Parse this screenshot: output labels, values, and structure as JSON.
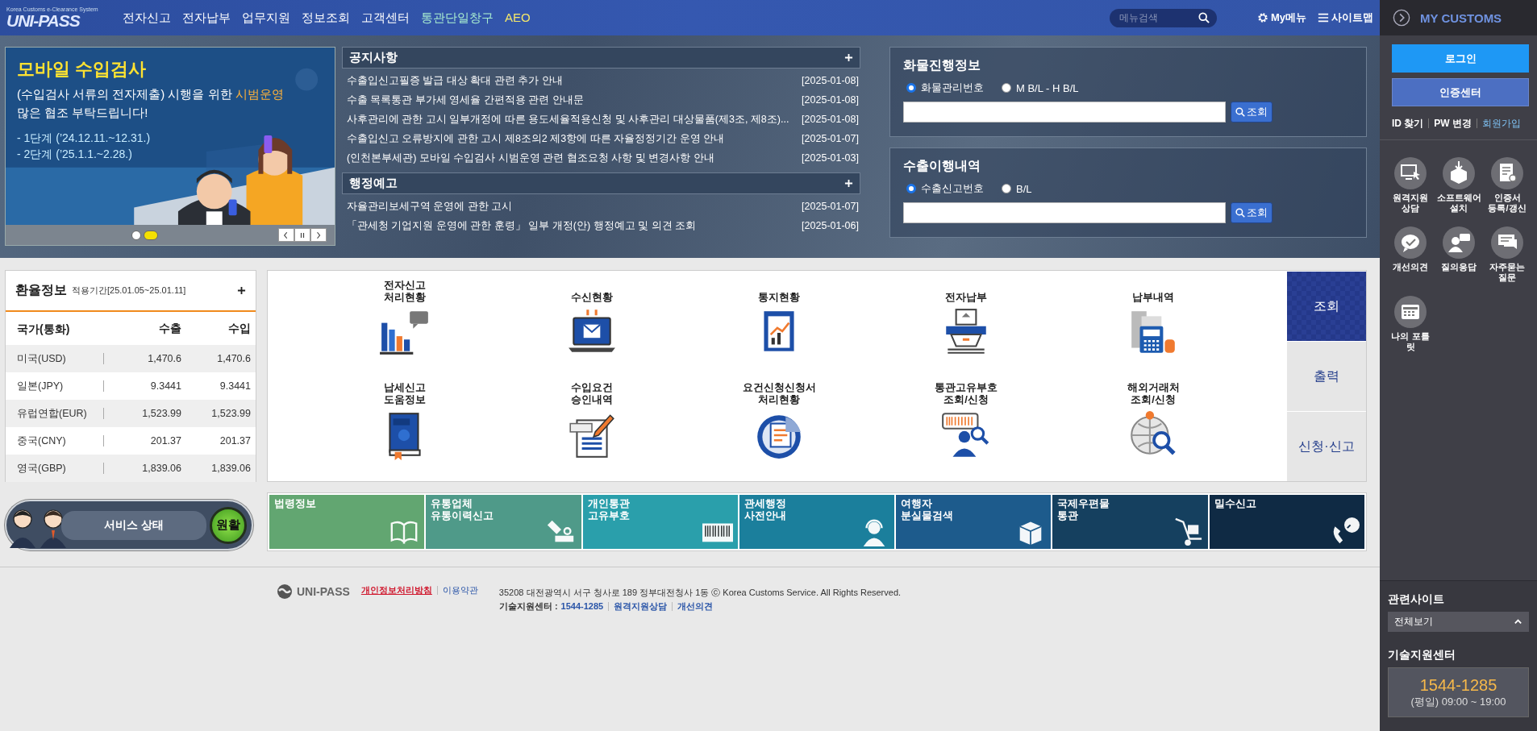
{
  "header": {
    "logo": {
      "tagline": "Korea Customs e-Clearance System",
      "name": "UNI-PASS"
    },
    "nav": [
      {
        "label": "전자신고",
        "color": "#ffffff"
      },
      {
        "label": "전자납부",
        "color": "#ffffff"
      },
      {
        "label": "업무지원",
        "color": "#ffffff"
      },
      {
        "label": "정보조회",
        "color": "#ffffff"
      },
      {
        "label": "고객센터",
        "color": "#ffffff"
      },
      {
        "label": "통관단일창구",
        "color": "#a8ecd0"
      },
      {
        "label": "AEO",
        "color": "#f4e76a"
      }
    ],
    "search": {
      "placeholder": "메뉴검색"
    },
    "utility_links": [
      {
        "label": "My메뉴",
        "kind": "gear"
      },
      {
        "label": "사이트맵",
        "kind": "menu"
      }
    ]
  },
  "banner": {
    "title": "모바일 수입검사",
    "subtitle": "(수입검사 서류의 전자제출) 시행을 위한",
    "highlight": "시범운영",
    "line": "많은 협조 부탁드립니다!",
    "steps": [
      "- 1단계 (’24.12.11.~12.31.)",
      "- 2단계 (’25.1.1.~2.28.)"
    ],
    "indicators": [
      {
        "selected": false
      },
      {
        "selected": true
      }
    ]
  },
  "notices": [
    {
      "title": "공지사항",
      "items": [
        {
          "title": "수출입신고필증 발급 대상 확대 관련 추가 안내",
          "date": "[2025-01-08]"
        },
        {
          "title": "수출 목록통관 부가세 영세율 간편적용 관련 안내문",
          "date": "[2025-01-08]"
        },
        {
          "title": "사후관리에 관한 고시 일부개정에 따른 용도세율적용신청 및 사후관리 대상물품(제3조, 제8조)...",
          "date": "[2025-01-08]"
        },
        {
          "title": "수출입신고 오류방지에 관한 고시 제8조의2 제3항에 따른 자율정정기간 운영 안내",
          "date": "[2025-01-07]"
        },
        {
          "title": "(인천본부세관) 모바일 수입검사 시범운영 관련 협조요청 사항 및 변경사항 안내",
          "date": "[2025-01-03]"
        }
      ]
    },
    {
      "title": "행정예고",
      "items": [
        {
          "title": "자율관리보세구역 운영에 관한 고시",
          "date": "[2025-01-07]"
        },
        {
          "title": "「관세청 기업지원 운영에 관한 훈령」 일부 개정(안) 행정예고 및 의견 조회",
          "date": "[2025-01-06]"
        }
      ]
    }
  ],
  "tracking": [
    {
      "title": "화물진행정보",
      "options": [
        {
          "label": "화물관리번호",
          "selected": true
        },
        {
          "label": "M B/L - H B/L",
          "selected": false
        }
      ],
      "button": "조회"
    },
    {
      "title": "수출이행내역",
      "options": [
        {
          "label": "수출신고번호",
          "selected": true
        },
        {
          "label": "B/L",
          "selected": false
        }
      ],
      "button": "조회"
    }
  ],
  "exchange": {
    "title": "환율정보",
    "period": "적용기간[25.01.05~25.01.11]",
    "columns": [
      "국가(통화)",
      "수출",
      "수입"
    ],
    "rows": [
      [
        "미국(USD)",
        "1,470.6",
        "1,470.6"
      ],
      [
        "일본(JPY)",
        "9.3441",
        "9.3441"
      ],
      [
        "유럽연합(EUR)",
        "1,523.99",
        "1,523.99"
      ],
      [
        "중국(CNY)",
        "201.37",
        "201.37"
      ],
      [
        "영국(GBP)",
        "1,839.06",
        "1,839.06"
      ]
    ]
  },
  "service_status": {
    "label": "서비스 상태",
    "status": "원활"
  },
  "quick_menu": {
    "items": [
      {
        "label": "전자신고\n처리현황",
        "kind": "chart"
      },
      {
        "label": "수신현황",
        "kind": "inbox"
      },
      {
        "label": "통지현황",
        "kind": "report"
      },
      {
        "label": "전자납부",
        "kind": "payment"
      },
      {
        "label": "납부내역",
        "kind": "receipt"
      },
      {
        "label": "납세신고\n도움정보",
        "kind": "help"
      },
      {
        "label": "수입요건\n승인내역",
        "kind": "import"
      },
      {
        "label": "요건신청신청서\n처리현황",
        "kind": "tax"
      },
      {
        "label": "통관고유부호\n조회/신청",
        "kind": "barcode"
      },
      {
        "label": "해외거래처\n조회/신청",
        "kind": "globe"
      }
    ],
    "tabs": [
      {
        "label": "조회",
        "selected": true
      },
      {
        "label": "출력",
        "selected": false
      },
      {
        "label": "신청·신고",
        "selected": false
      }
    ]
  },
  "tiles": [
    {
      "label": "법령정보",
      "color": "#62a671",
      "kind": "book"
    },
    {
      "label": "유통업체\n유통이력신고",
      "color": "#4f9a89",
      "kind": "eraser"
    },
    {
      "label": "개인통관\n고유부호",
      "color": "#2a9fab",
      "kind": "barcode"
    },
    {
      "label": "관세행정\n사전안내",
      "color": "#1b7f9c",
      "kind": "headset"
    },
    {
      "label": "여행자\n분실물검색",
      "color": "#1d5b8c",
      "kind": "box"
    },
    {
      "label": "국제우편물\n통관",
      "color": "#15405f",
      "kind": "cart"
    },
    {
      "label": "밀수신고",
      "color": "#0f2a44",
      "kind": "phone"
    }
  ],
  "footer": {
    "logo": "UNI-PASS",
    "links": [
      {
        "label": "개인정보처리방침",
        "kind": "privacy"
      },
      {
        "label": "이용약관",
        "kind": "normal"
      }
    ],
    "address": "35208 대전광역시 서구 청사로 189 정부대전청사 1동 ⓒ Korea Customs Service. All Rights Reserved.",
    "support_label": "기술지원센터 :",
    "support_phone": "1544-1285",
    "support_links": [
      "원격지원상담",
      "개선의견"
    ]
  },
  "sidebar": {
    "title": "MY CUSTOMS",
    "buttons": [
      {
        "label": "로그인",
        "kind": "primary"
      },
      {
        "label": "인증센터",
        "kind": "secondary"
      }
    ],
    "links": [
      {
        "label": "ID 찾기",
        "kind": "normal"
      },
      {
        "label": "PW 변경",
        "kind": "normal"
      },
      {
        "label": "회원가입",
        "kind": "accent"
      }
    ],
    "shortcuts": [
      {
        "label": "원격지원\n상담",
        "kind": "monitor"
      },
      {
        "label": "소프트웨어\n설치",
        "kind": "install"
      },
      {
        "label": "인증서\n등록/갱신",
        "kind": "certificate"
      },
      {
        "label": "개선의견",
        "kind": "check"
      },
      {
        "label": "질의응답",
        "kind": "person"
      },
      {
        "label": "자주묻는\n질문",
        "kind": "chat"
      },
      {
        "label": "나의 포틀\n릿",
        "kind": "calendar"
      }
    ],
    "related": {
      "title": "관련사이트",
      "select": "전체보기"
    },
    "support": {
      "title": "기술지원센터",
      "phone": "1544-1285",
      "hours": "(평일) 09:00 ~ 19:00"
    }
  }
}
